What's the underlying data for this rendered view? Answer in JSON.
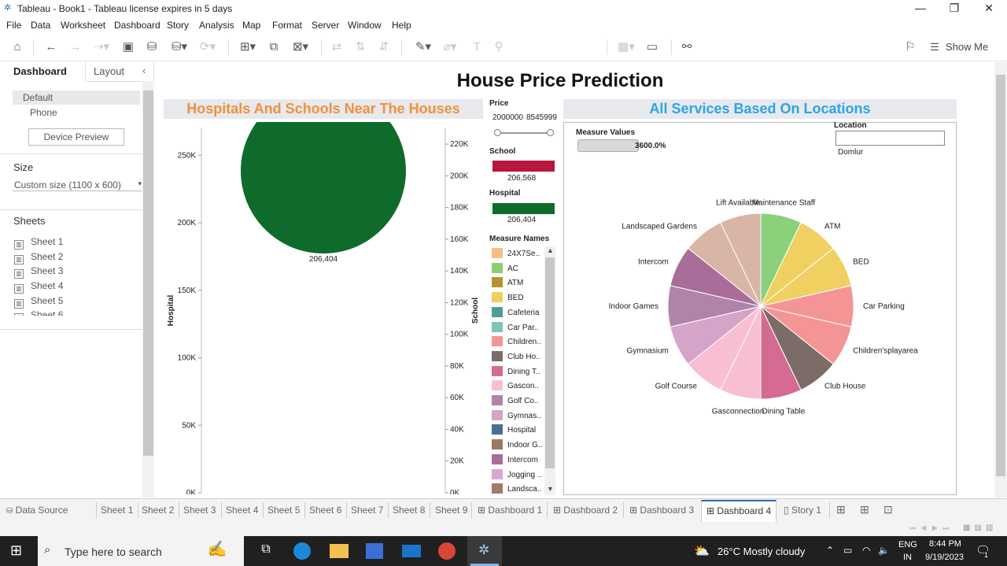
{
  "window": {
    "title": "Tableau - Book1 - Tableau license expires in 5 days"
  },
  "menu": [
    "File",
    "Data",
    "Worksheet",
    "Dashboard",
    "Story",
    "Analysis",
    "Map",
    "Format",
    "Server",
    "Window",
    "Help"
  ],
  "toolbar": {
    "show_me": "Show Me"
  },
  "left_panel": {
    "tab_dashboard": "Dashboard",
    "tab_layout": "Layout",
    "devices": [
      "Default",
      "Phone"
    ],
    "device_preview": "Device Preview",
    "size_title": "Size",
    "size_value": "Custom size (1100 x 600)",
    "sheets_title": "Sheets",
    "sheets": [
      "Sheet 1",
      "Sheet 2",
      "Sheet 3",
      "Sheet 4",
      "Sheet 5",
      "Sheet 6"
    ]
  },
  "dashboard": {
    "title": "House Price Prediction",
    "left_header": "Hospitals And Schools Near The Houses",
    "right_header": "All Services Based On Locations",
    "left_axis_title": "Hospital",
    "right_axis_title": "School",
    "left_ticks": [
      "250K",
      "200K",
      "150K",
      "100K",
      "50K",
      "0K"
    ],
    "right_ticks": [
      "220K",
      "200K",
      "180K",
      "160K",
      "140K",
      "120K",
      "100K",
      "80K",
      "60K",
      "40K",
      "20K",
      "0K"
    ],
    "bubble_school_value": "206,568",
    "bubble_hospital_value": "206,404",
    "price_filter": {
      "title": "Price",
      "min": "2000000",
      "max": "8545999"
    },
    "school_legend": {
      "title": "School",
      "value": "206,568",
      "color": "#b5173f"
    },
    "hospital_legend": {
      "title": "Hospital",
      "value": "206,404",
      "color": "#0e6b2c"
    },
    "measure_names_title": "Measure Names",
    "measure_names": [
      {
        "label": "24X7Se..",
        "color": "#f9bd82"
      },
      {
        "label": "AC",
        "color": "#8bd06f"
      },
      {
        "label": "ATM",
        "color": "#b7922e"
      },
      {
        "label": "BED",
        "color": "#f0cd5e"
      },
      {
        "label": "Cafeteria",
        "color": "#4b9f98"
      },
      {
        "label": "Car Par..",
        "color": "#82c3b9"
      },
      {
        "label": "Children..",
        "color": "#f59494"
      },
      {
        "label": "Club Ho..",
        "color": "#7c6c67"
      },
      {
        "label": "Dining T..",
        "color": "#d56b93"
      },
      {
        "label": "Gascon..",
        "color": "#f8bed2"
      },
      {
        "label": "Golf Co..",
        "color": "#b083a8"
      },
      {
        "label": "Gymnas..",
        "color": "#d6a4c8"
      },
      {
        "label": "Hospital",
        "color": "#4a6d96"
      },
      {
        "label": "Indoor G..",
        "color": "#9c7a64"
      },
      {
        "label": "Intercom",
        "color": "#a96d99"
      },
      {
        "label": "Jogging ..",
        "color": "#d7a9d2"
      },
      {
        "label": "Landsca..",
        "color": "#a07a6a"
      }
    ],
    "measure_values_title": "Measure Values",
    "measure_values_value": "3600.0%",
    "location_title": "Location",
    "location_value": "Domlur"
  },
  "chart_data": [
    {
      "type": "scatter",
      "title": "Hospitals And Schools Near The Houses",
      "ylabel": "Hospital",
      "y2label": "School",
      "ylim": [
        0,
        270000
      ],
      "y2lim": [
        0,
        230000
      ],
      "series": [
        {
          "name": "Hospital",
          "values": [
            206404
          ],
          "color": "#0e6b2c"
        },
        {
          "name": "School",
          "values": [
            206568
          ],
          "color": "#b5173f"
        }
      ]
    },
    {
      "type": "pie",
      "title": "All Services Based On Locations",
      "slices": [
        {
          "label": "Maintenance Staff",
          "value": 1,
          "color": "#8bd07a"
        },
        {
          "label": "ATM",
          "value": 1,
          "color": "#f0d060"
        },
        {
          "label": "BED",
          "value": 1,
          "color": "#f0d060"
        },
        {
          "label": "Car Parking",
          "value": 1,
          "color": "#f59494"
        },
        {
          "label": "Children'splayarea",
          "value": 1,
          "color": "#f59494"
        },
        {
          "label": "Club House",
          "value": 1,
          "color": "#7c6c67"
        },
        {
          "label": "Dining Table",
          "value": 1,
          "color": "#d56b93"
        },
        {
          "label": "Gasconnection",
          "value": 1,
          "color": "#f8bed2"
        },
        {
          "label": "Golf Course",
          "value": 1,
          "color": "#f8bed2"
        },
        {
          "label": "Gymnasium",
          "value": 1,
          "color": "#d6a4c8"
        },
        {
          "label": "Indoor Games",
          "value": 1,
          "color": "#b083a8"
        },
        {
          "label": "Intercom",
          "value": 1,
          "color": "#a96d99"
        },
        {
          "label": "Landscaped Gardens",
          "value": 1,
          "color": "#d9b5a8"
        },
        {
          "label": "Lift Available",
          "value": 1,
          "color": "#d9b5a8"
        }
      ]
    }
  ],
  "sheet_tabs": [
    "Data Source",
    "Sheet 1",
    "Sheet 2",
    "Sheet 3",
    "Sheet 4",
    "Sheet 5",
    "Sheet 6",
    "Sheet 7",
    "Sheet 8",
    "Sheet 9",
    "Dashboard 1",
    "Dashboard 2",
    "Dashboard 3",
    "Dashboard 4",
    "Story 1"
  ],
  "taskbar": {
    "search_placeholder": "Type here to search",
    "weather": "26°C  Mostly cloudy",
    "lang1": "ENG",
    "lang2": "IN",
    "time": "8:44 PM",
    "date": "9/19/2023",
    "notif_count": "1"
  }
}
